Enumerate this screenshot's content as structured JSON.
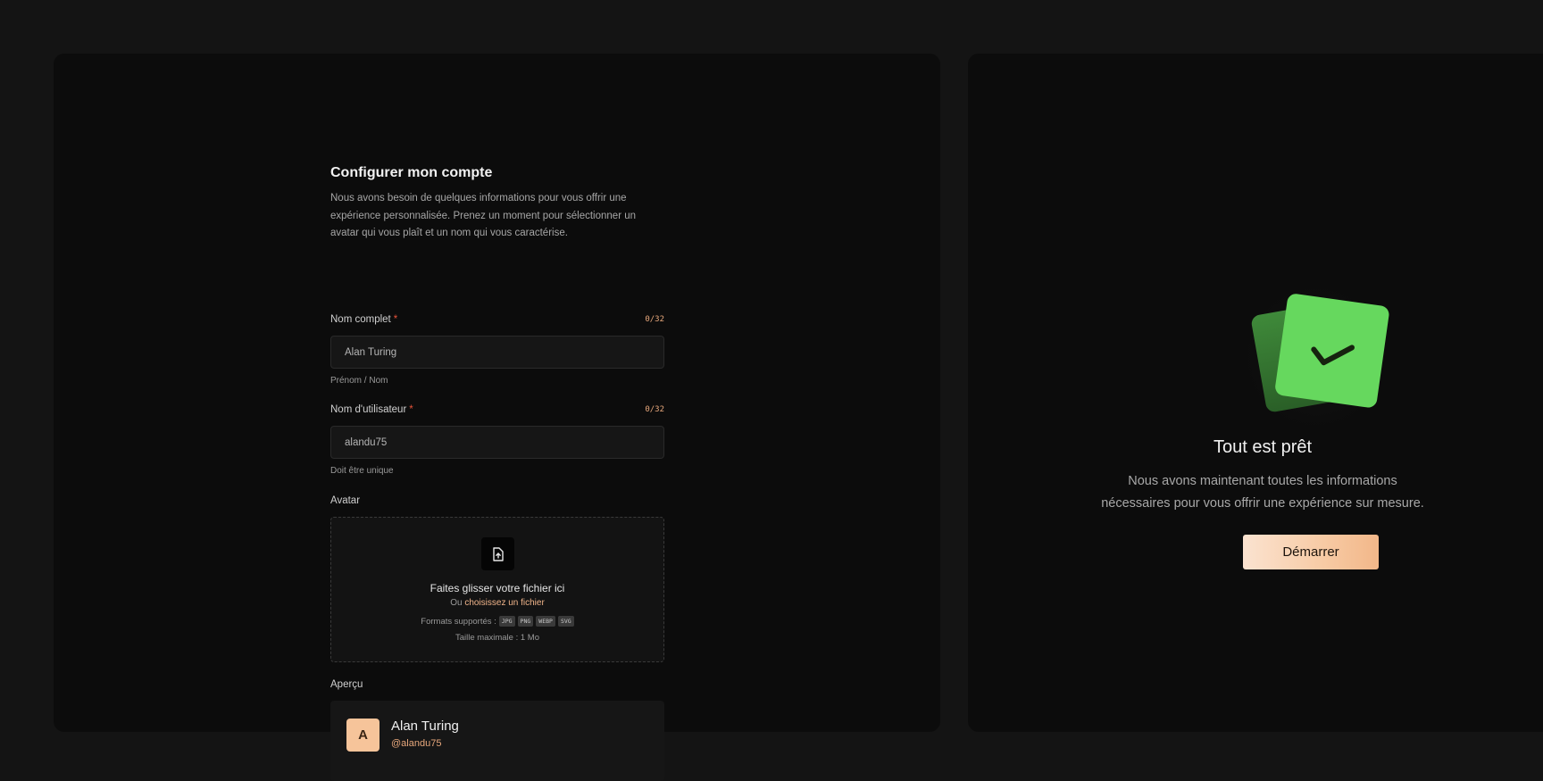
{
  "form": {
    "title": "Configurer mon compte",
    "description": "Nous avons besoin de quelques informations pour vous offrir une expérience personnalisée. Prenez un moment pour sélectionner un avatar qui vous plaît et un nom qui vous caractérise.",
    "fullname": {
      "label": "Nom complet",
      "required_mark": "*",
      "counter": "0/32",
      "value": "Alan Turing",
      "hint": "Prénom / Nom"
    },
    "username": {
      "label": "Nom d'utilisateur",
      "required_mark": "*",
      "counter": "0/32",
      "value": "alandu75",
      "hint": "Doit être unique"
    },
    "avatar": {
      "label": "Avatar",
      "drop_title": "Faites glisser votre fichier ici",
      "or_text": "Ou",
      "choose_link": "choisissez un fichier",
      "formats_label": "Formats supportés :",
      "formats": [
        "JPG",
        "PNG",
        "WEBP",
        "SVG"
      ],
      "max_size": "Taille maximale : 1 Mo"
    },
    "preview": {
      "label": "Aperçu",
      "initial": "A",
      "name": "Alan Turing",
      "username": "@alandu75"
    }
  },
  "ready": {
    "title": "Tout est prêt",
    "description": "Nous avons maintenant toutes les informations nécessaires pour vous offrir une expérience sur mesure.",
    "button": "Démarrer"
  },
  "colors": {
    "accent": "#f6c49a",
    "check_green": "#66d85e",
    "required": "#e5533a"
  }
}
